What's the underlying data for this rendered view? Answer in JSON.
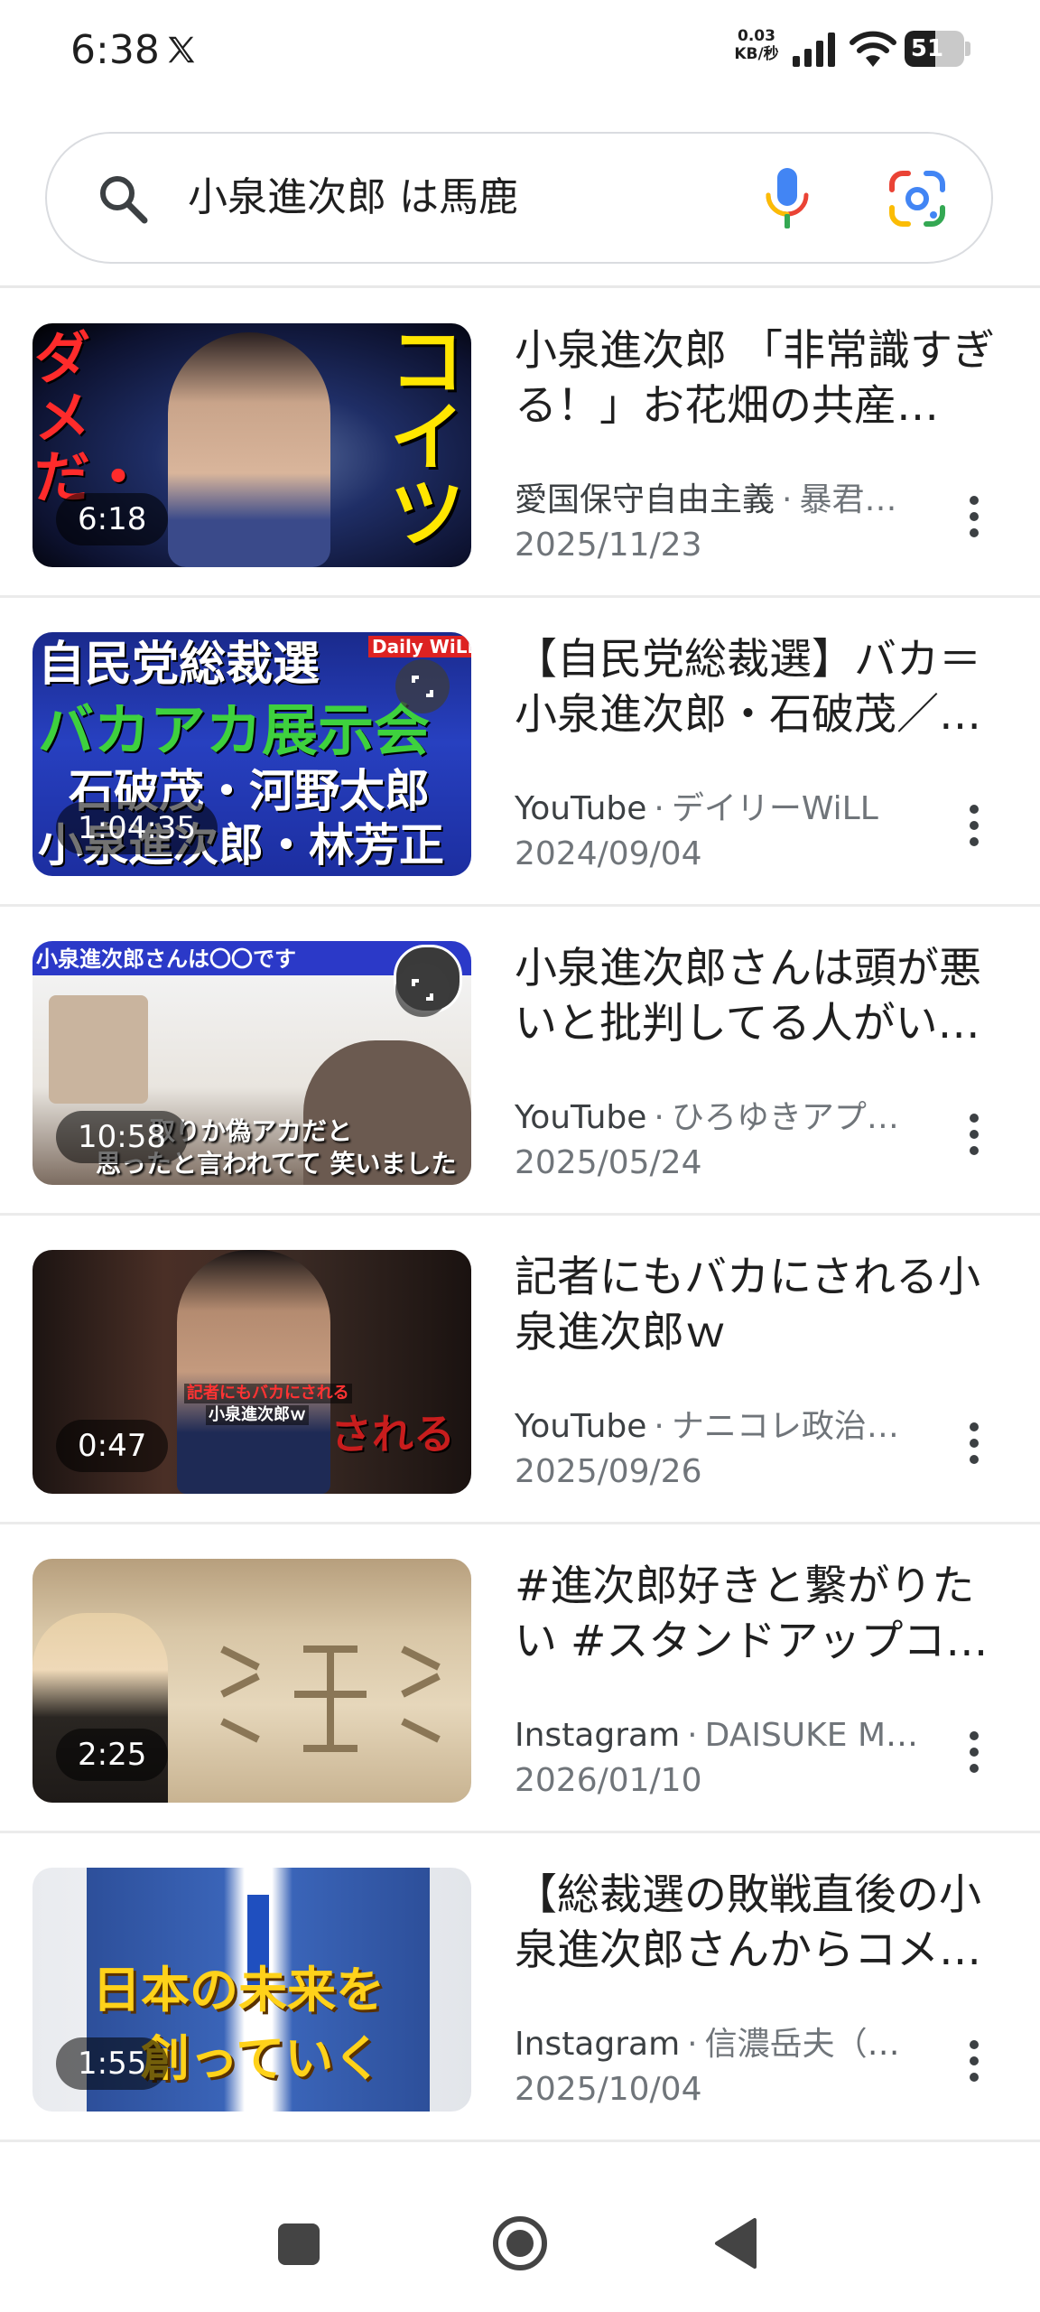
{
  "status_bar": {
    "time": "6:38",
    "net_speed_value": "0.03",
    "net_speed_unit": "KB/秒",
    "battery": "51",
    "battery_level": 0.51
  },
  "search": {
    "query": "小泉進次郎 は馬鹿"
  },
  "results": [
    {
      "title": "小泉進次郎 「非常識すぎる！」お花畑の共産…",
      "platform": "愛国保守自由主義",
      "channel": "暴君…",
      "date": "2025/11/23",
      "duration": "6:18",
      "thumb_texts": [
        "ダメだ・",
        "コイツ"
      ]
    },
    {
      "title": "【自民党総裁選】バカ＝小泉進次郎・石破茂／…",
      "platform": "YouTube",
      "channel": "デイリーWiLL",
      "date": "2024/09/04",
      "duration": "1:04:35",
      "thumb_texts": [
        "自民党総裁選",
        "Daily WiLL",
        "バカアカ展示会",
        "石破茂・河野太郎",
        "小泉進次郎・林芳正"
      ]
    },
    {
      "title": "小泉進次郎さんは頭が悪いと批判してる人がい…",
      "platform": "YouTube",
      "channel": "ひろゆきアプ…",
      "date": "2025/05/24",
      "duration": "10:58",
      "thumb_texts": [
        "小泉進次郎さんは〇〇です",
        "取りか偽アカだと",
        "思ったと言われてて 笑いました"
      ]
    },
    {
      "title": "記者にもバカにされる小泉進次郎ｗ",
      "platform": "YouTube",
      "channel": "ナニコレ政治…",
      "date": "2025/09/26",
      "duration": "0:47",
      "thumb_texts": [
        "記者にもバカにされる",
        "小泉進次郎ｗ",
        "される"
      ]
    },
    {
      "title": "#進次郎好きと繋がりたい #スタンドアップコ…",
      "platform": "Instagram",
      "channel": "DAISUKE MU…",
      "date": "2026/01/10",
      "duration": "2:25",
      "thumb_texts": []
    },
    {
      "title": "【総裁選の敗戦直後の小泉進次郎さんからコメ…",
      "platform": "Instagram",
      "channel": "信濃岳夫（ワ…",
      "date": "2025/10/04",
      "duration": "1:55",
      "thumb_texts": [
        "日本の未来を",
        "創っていく"
      ]
    }
  ],
  "colors": {
    "google_blue": "#4285F4",
    "google_red": "#EA4335",
    "google_yellow": "#FBBC05",
    "google_green": "#34A853",
    "text_primary": "#1f1f1f",
    "text_secondary": "#70757a"
  },
  "icons": {
    "status": [
      "x-logo-icon",
      "signal-icon",
      "wifi-icon",
      "battery-icon"
    ],
    "search": [
      "search-icon",
      "mic-icon",
      "google-lens-icon"
    ],
    "result": [
      "more-vert-icon",
      "expand-icon"
    ],
    "nav": [
      "recents-square-icon",
      "home-circle-icon",
      "back-triangle-icon"
    ]
  }
}
